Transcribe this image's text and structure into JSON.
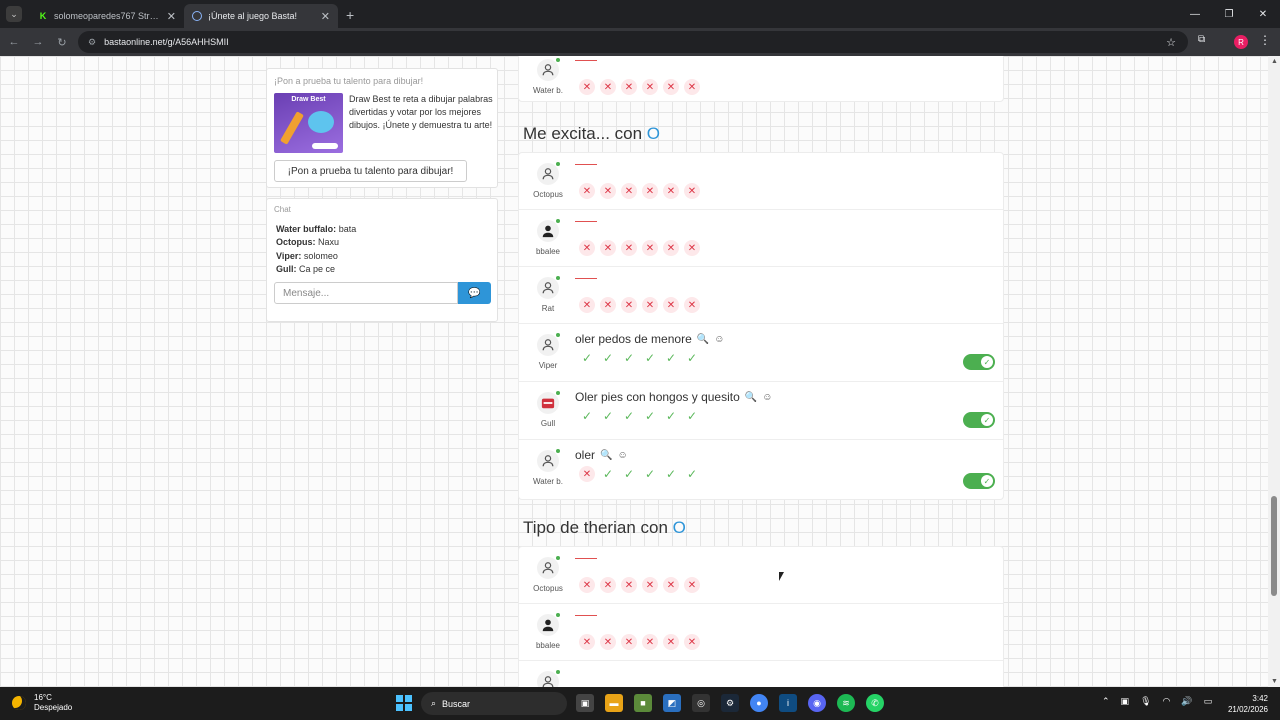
{
  "browser": {
    "tabs": [
      {
        "title": "solomeoparedes767 Stream - ..."
      },
      {
        "title": "¡Únete al juego Basta!"
      }
    ],
    "url": "bastaonline.net/g/A56AHHSMII"
  },
  "ad": {
    "title": "¡Pon a prueba tu talento para dibujar!",
    "brand": "Draw Best",
    "description": "Draw Best te reta a dibujar palabras divertidas y votar por los mejores dibujos. ¡Únete y demuestra tu arte!",
    "button": "¡Pon a prueba tu talento para dibujar!"
  },
  "chat": {
    "title": "Chat",
    "messages": [
      {
        "user": "Water buffalo:",
        "text": "bata"
      },
      {
        "user": "Octopus:",
        "text": "Naxu"
      },
      {
        "user": "Viper:",
        "text": "solomeo"
      },
      {
        "user": "Gull:",
        "text": "Ca pe ce"
      }
    ],
    "placeholder": "Mensaje..."
  },
  "sections": [
    {
      "title": "",
      "letter": "",
      "rows": [
        {
          "player": "Water b.",
          "answer": "",
          "votes": [
            false,
            false,
            false,
            false,
            false,
            false
          ],
          "toggle": false
        }
      ]
    },
    {
      "title": "Me excita... con",
      "letter": "O",
      "rows": [
        {
          "player": "Octopus",
          "answer": "",
          "votes": [
            false,
            false,
            false,
            false,
            false,
            false
          ],
          "toggle": false
        },
        {
          "player": "bbalee",
          "answer": "",
          "votes": [
            false,
            false,
            false,
            false,
            false,
            false
          ],
          "toggle": false
        },
        {
          "player": "Rat",
          "answer": "",
          "votes": [
            false,
            false,
            false,
            false,
            false,
            false
          ],
          "toggle": false
        },
        {
          "player": "Viper",
          "answer": "oler pedos de menore",
          "votes": [
            true,
            true,
            true,
            true,
            true,
            true
          ],
          "toggle": true
        },
        {
          "player": "Gull",
          "answer": "Oler pies con hongos y quesito",
          "votes": [
            true,
            true,
            true,
            true,
            true,
            true
          ],
          "toggle": true
        },
        {
          "player": "Water b.",
          "answer": "oler",
          "votes": [
            false,
            true,
            true,
            true,
            true,
            true
          ],
          "toggle": true
        }
      ]
    },
    {
      "title": "Tipo de therian con",
      "letter": "O",
      "rows": [
        {
          "player": "Octopus",
          "answer": "",
          "votes": [
            false,
            false,
            false,
            false,
            false,
            false
          ],
          "toggle": false
        },
        {
          "player": "bbalee",
          "answer": "",
          "votes": [
            false,
            false,
            false,
            false,
            false,
            false
          ],
          "toggle": false
        },
        {
          "player": "",
          "answer": "",
          "votes": [],
          "toggle": false
        }
      ]
    }
  ],
  "taskbar": {
    "temp": "16°C",
    "weather": "Despejado",
    "search": "Buscar",
    "time": "3:42",
    "date": "21/02/2026"
  },
  "colors": {
    "accent": "#2e95d8",
    "good": "#4caf50",
    "bad": "#dc3545"
  }
}
